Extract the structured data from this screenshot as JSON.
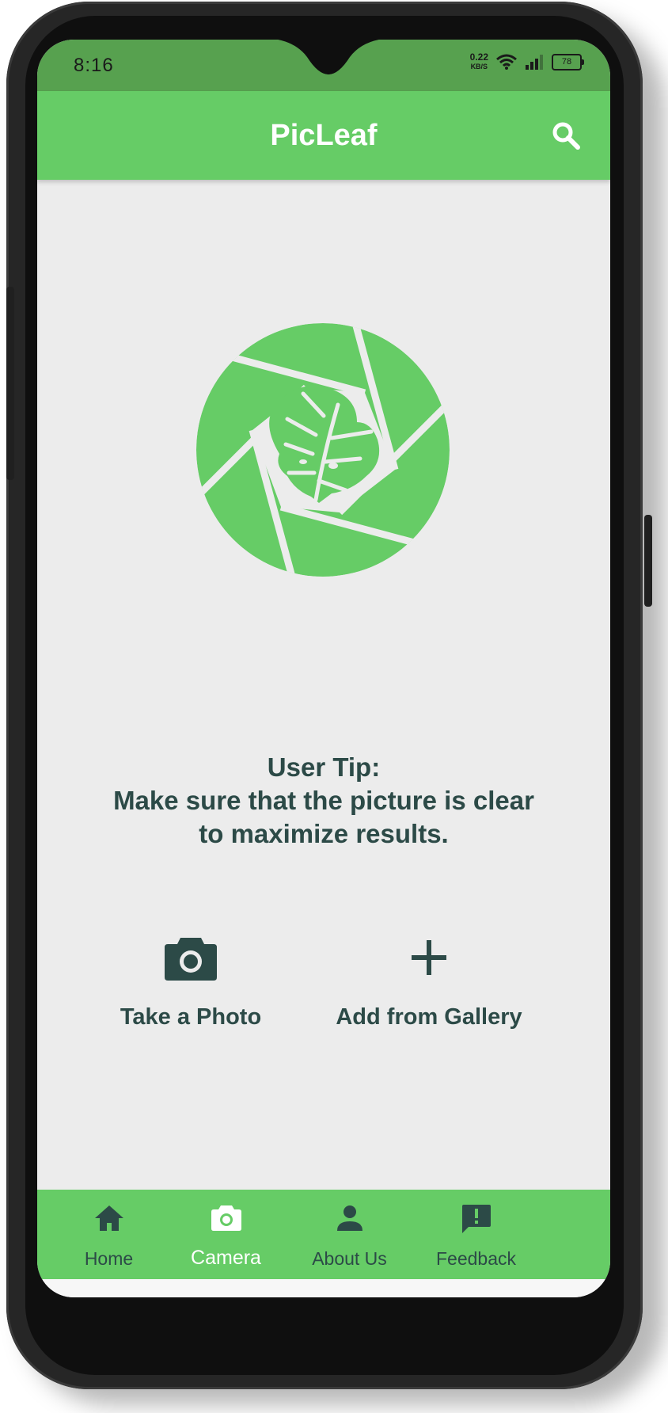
{
  "status_bar": {
    "time": "8:16",
    "net_speed_value": "0.22",
    "net_speed_unit": "KB/S",
    "battery": "78"
  },
  "app_bar": {
    "title": "PicLeaf",
    "search_icon": "search-icon"
  },
  "tip": {
    "line1": "User Tip:",
    "line2": "Make sure that the picture is clear",
    "line3": "to maximize results."
  },
  "actions": {
    "take_photo_label": "Take a Photo",
    "add_gallery_label": "Add from Gallery"
  },
  "bottom_nav": {
    "items": [
      {
        "label": "Home",
        "icon": "home-icon",
        "active": false
      },
      {
        "label": "Camera",
        "icon": "camera-icon",
        "active": true
      },
      {
        "label": "About Us",
        "icon": "person-icon",
        "active": false
      },
      {
        "label": "Feedback",
        "icon": "feedback-icon",
        "active": false
      }
    ]
  },
  "colors": {
    "primary_green": "#66cc66",
    "status_green": "#57a14f",
    "text_dark": "#2c4a47",
    "background": "#ececec"
  }
}
